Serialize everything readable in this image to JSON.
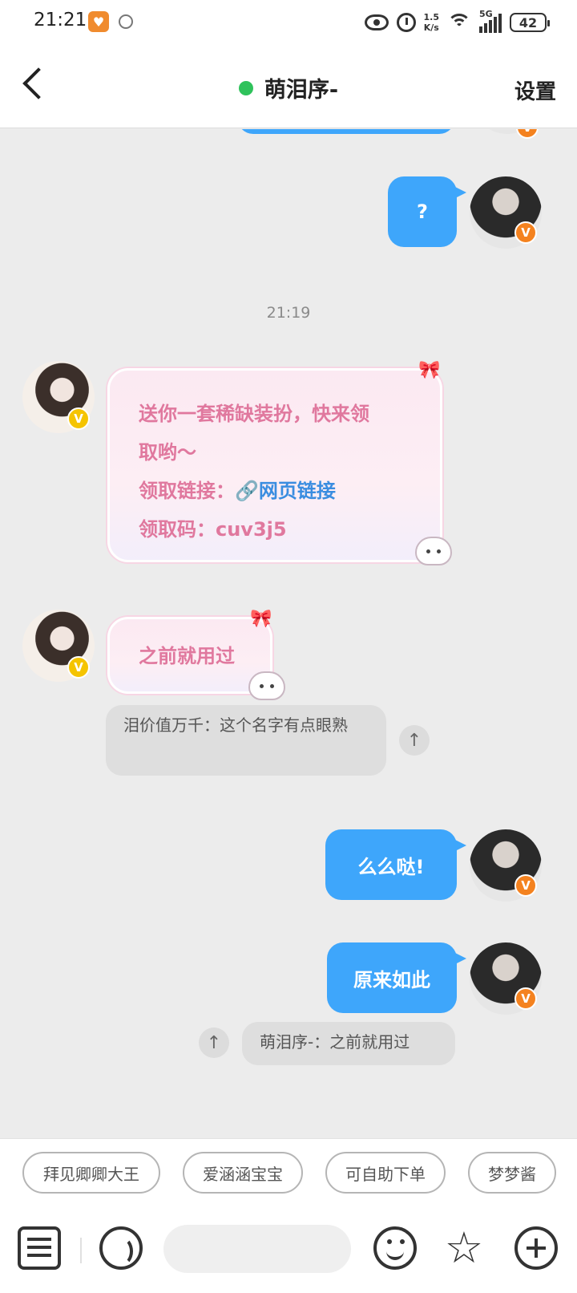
{
  "status_bar": {
    "time": "21:21",
    "net_speed_top": "1.5",
    "net_speed_bottom": "K/s",
    "network": "5G",
    "battery": "42"
  },
  "nav": {
    "title": "萌泪序-",
    "settings_label": "设置"
  },
  "chat": {
    "messages": {
      "question": "?",
      "time": "21:19",
      "gift_line1": "送你一套稀缺装扮，快来领",
      "gift_line2": "取哟～",
      "gift_link_label": "领取链接：",
      "gift_link_text": "网页链接",
      "gift_code": "领取码：cuv3j5",
      "used_before": "之前就用过",
      "quote1": "泪价值万千：这个名字有点眼熟",
      "kiss": "么么哒!",
      "i_see": "原来如此",
      "quote2": "萌泪序-：之前就用过"
    }
  },
  "quick_replies": [
    "拜见卿卿大王",
    "爱涵涵宝宝",
    "可自助下单",
    "梦梦酱"
  ],
  "input": {
    "value": ""
  },
  "colors": {
    "accent_blue": "#3ea6fb",
    "online_green": "#2fc25b",
    "pink_text": "#e0789e",
    "vip_orange": "#f4821f",
    "vip_yellow": "#f5c400"
  }
}
